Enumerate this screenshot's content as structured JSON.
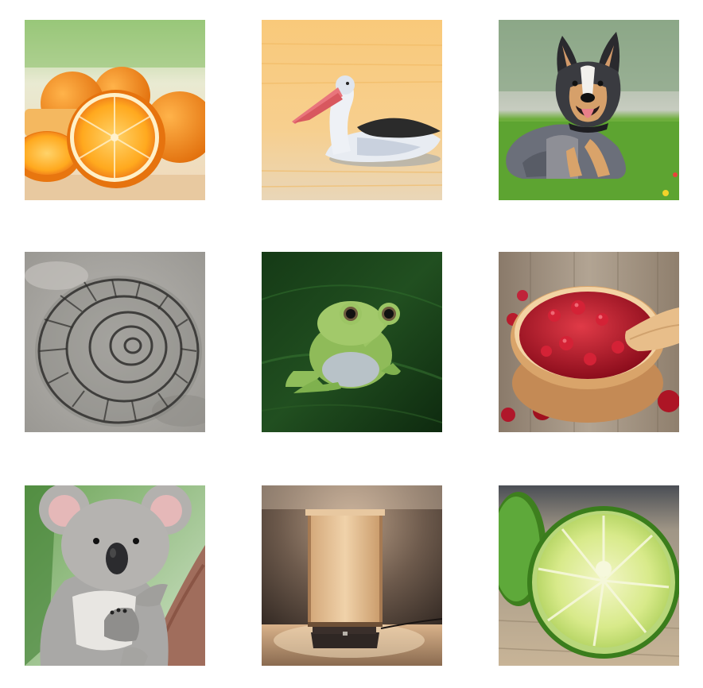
{
  "grid": {
    "tiles": [
      {
        "icon": "oranges-image"
      },
      {
        "icon": "pelican-image"
      },
      {
        "icon": "dog-image"
      },
      {
        "icon": "ammonite-fossil-image"
      },
      {
        "icon": "frog-image"
      },
      {
        "icon": "cranberry-sauce-image"
      },
      {
        "icon": "koala-image"
      },
      {
        "icon": "table-lamp-image"
      },
      {
        "icon": "lime-image"
      }
    ]
  }
}
